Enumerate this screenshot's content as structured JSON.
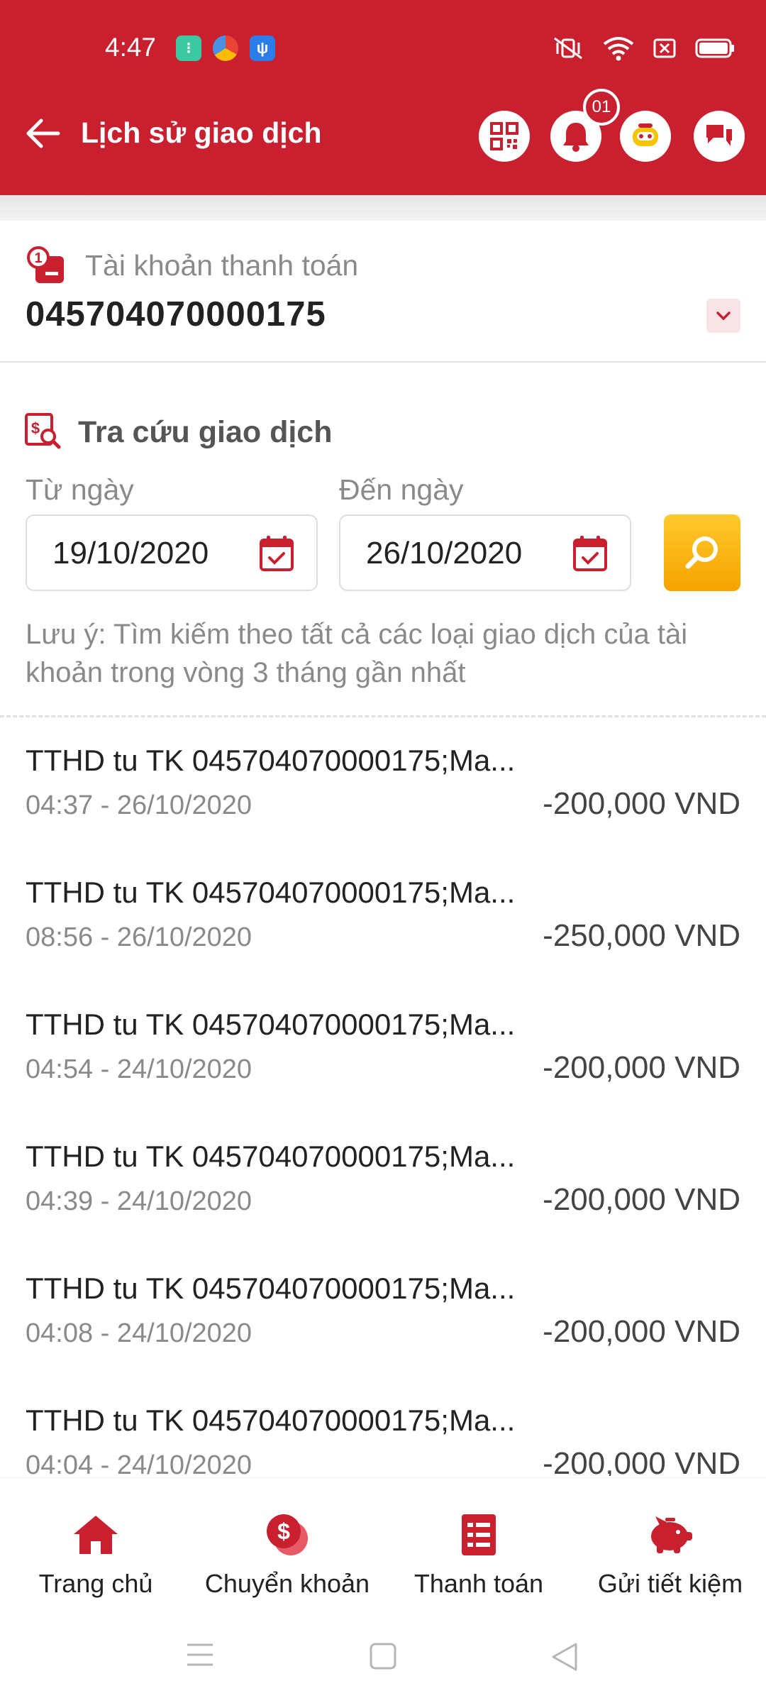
{
  "status_bar": {
    "time": "4:47"
  },
  "header": {
    "title": "Lịch sử giao dịch",
    "notification_badge": "01",
    "accent_color": "#c8202f"
  },
  "account": {
    "label": "Tài khoản thanh toán",
    "number": "045704070000175"
  },
  "search": {
    "title": "Tra cứu giao dịch",
    "from_label": "Từ ngày",
    "to_label": "Đến ngày",
    "from_date": "19/10/2020",
    "to_date": "26/10/2020",
    "note": "Lưu ý: Tìm kiếm theo tất cả các loại giao dịch của tài khoản trong vòng 3 tháng gần nhất"
  },
  "transactions": [
    {
      "description": "TTHD tu TK 045704070000175;Ma...",
      "time": "04:37 - 26/10/2020",
      "amount": "-200,000 VND"
    },
    {
      "description": "TTHD tu TK 045704070000175;Ma...",
      "time": "08:56 - 26/10/2020",
      "amount": "-250,000 VND"
    },
    {
      "description": "TTHD tu TK 045704070000175;Ma...",
      "time": "04:54 - 24/10/2020",
      "amount": "-200,000 VND"
    },
    {
      "description": "TTHD tu TK 045704070000175;Ma...",
      "time": "04:39 - 24/10/2020",
      "amount": "-200,000 VND"
    },
    {
      "description": "TTHD tu TK 045704070000175;Ma...",
      "time": "04:08 - 24/10/2020",
      "amount": "-200,000 VND"
    },
    {
      "description": "TTHD tu TK 045704070000175;Ma...",
      "time": "04:04 - 24/10/2020",
      "amount": "-200,000 VND"
    }
  ],
  "bottom_nav": [
    {
      "label": "Trang chủ",
      "icon": "home-icon"
    },
    {
      "label": "Chuyển khoản",
      "icon": "money-transfer-icon"
    },
    {
      "label": "Thanh toán",
      "icon": "bill-icon"
    },
    {
      "label": "Gửi tiết kiệm",
      "icon": "piggy-bank-icon"
    }
  ]
}
